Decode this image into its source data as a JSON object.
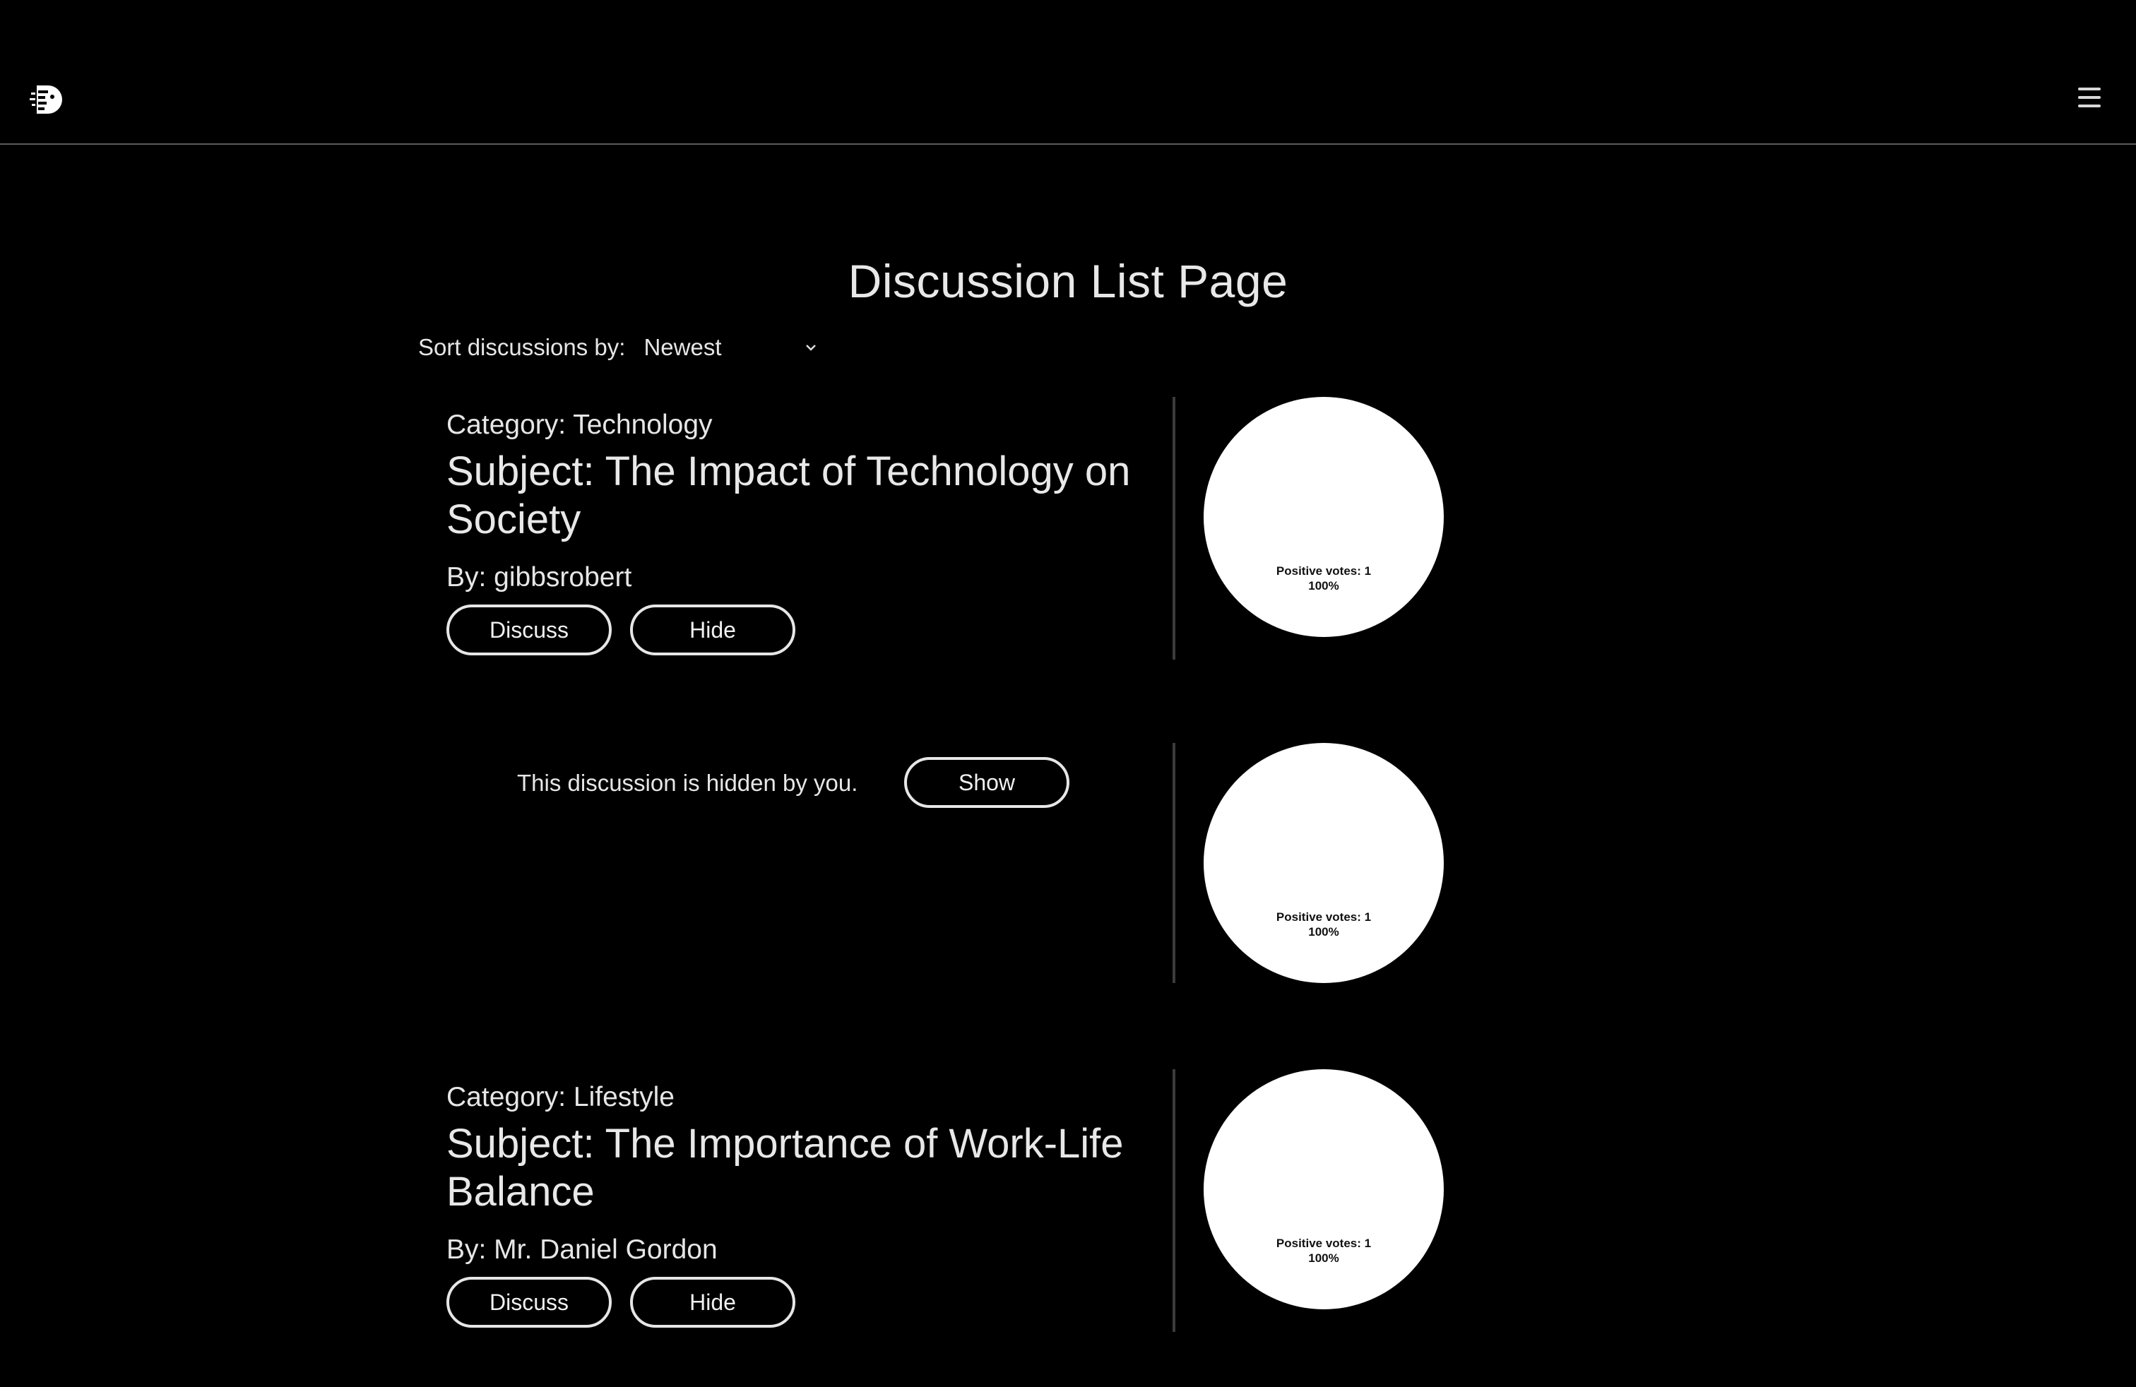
{
  "header": {
    "logo_icon": "discussion-logo-icon",
    "menu_icon": "hamburger-menu-icon"
  },
  "page": {
    "title": "Discussion List Page",
    "sort_label": "Sort discussions by:",
    "sort_value": "Newest"
  },
  "discussions": [
    {
      "category": "Category: Technology",
      "subject_line1": "Subject: The Impact of Technology on",
      "subject_line2": "Society",
      "author": "By: gibbsrobert",
      "discuss_label": "Discuss",
      "hide_label": "Hide",
      "votes_label": "Positive votes: 1",
      "votes_percent": "100%"
    },
    {
      "hidden_message": "This discussion is hidden by you.",
      "show_label": "Show",
      "votes_label": "Positive votes: 1",
      "votes_percent": "100%"
    },
    {
      "category": "Category: Lifestyle",
      "subject_line1": "Subject: The Importance of Work-Life",
      "subject_line2": "Balance",
      "author": "By: Mr. Daniel Gordon",
      "discuss_label": "Discuss",
      "hide_label": "Hide",
      "votes_label": "Positive votes: 1",
      "votes_percent": "100%"
    }
  ],
  "colors": {
    "background": "#000000",
    "text": "#e6e6e6",
    "pie_fill": "#ffffff",
    "divider": "#3c3c3c"
  }
}
